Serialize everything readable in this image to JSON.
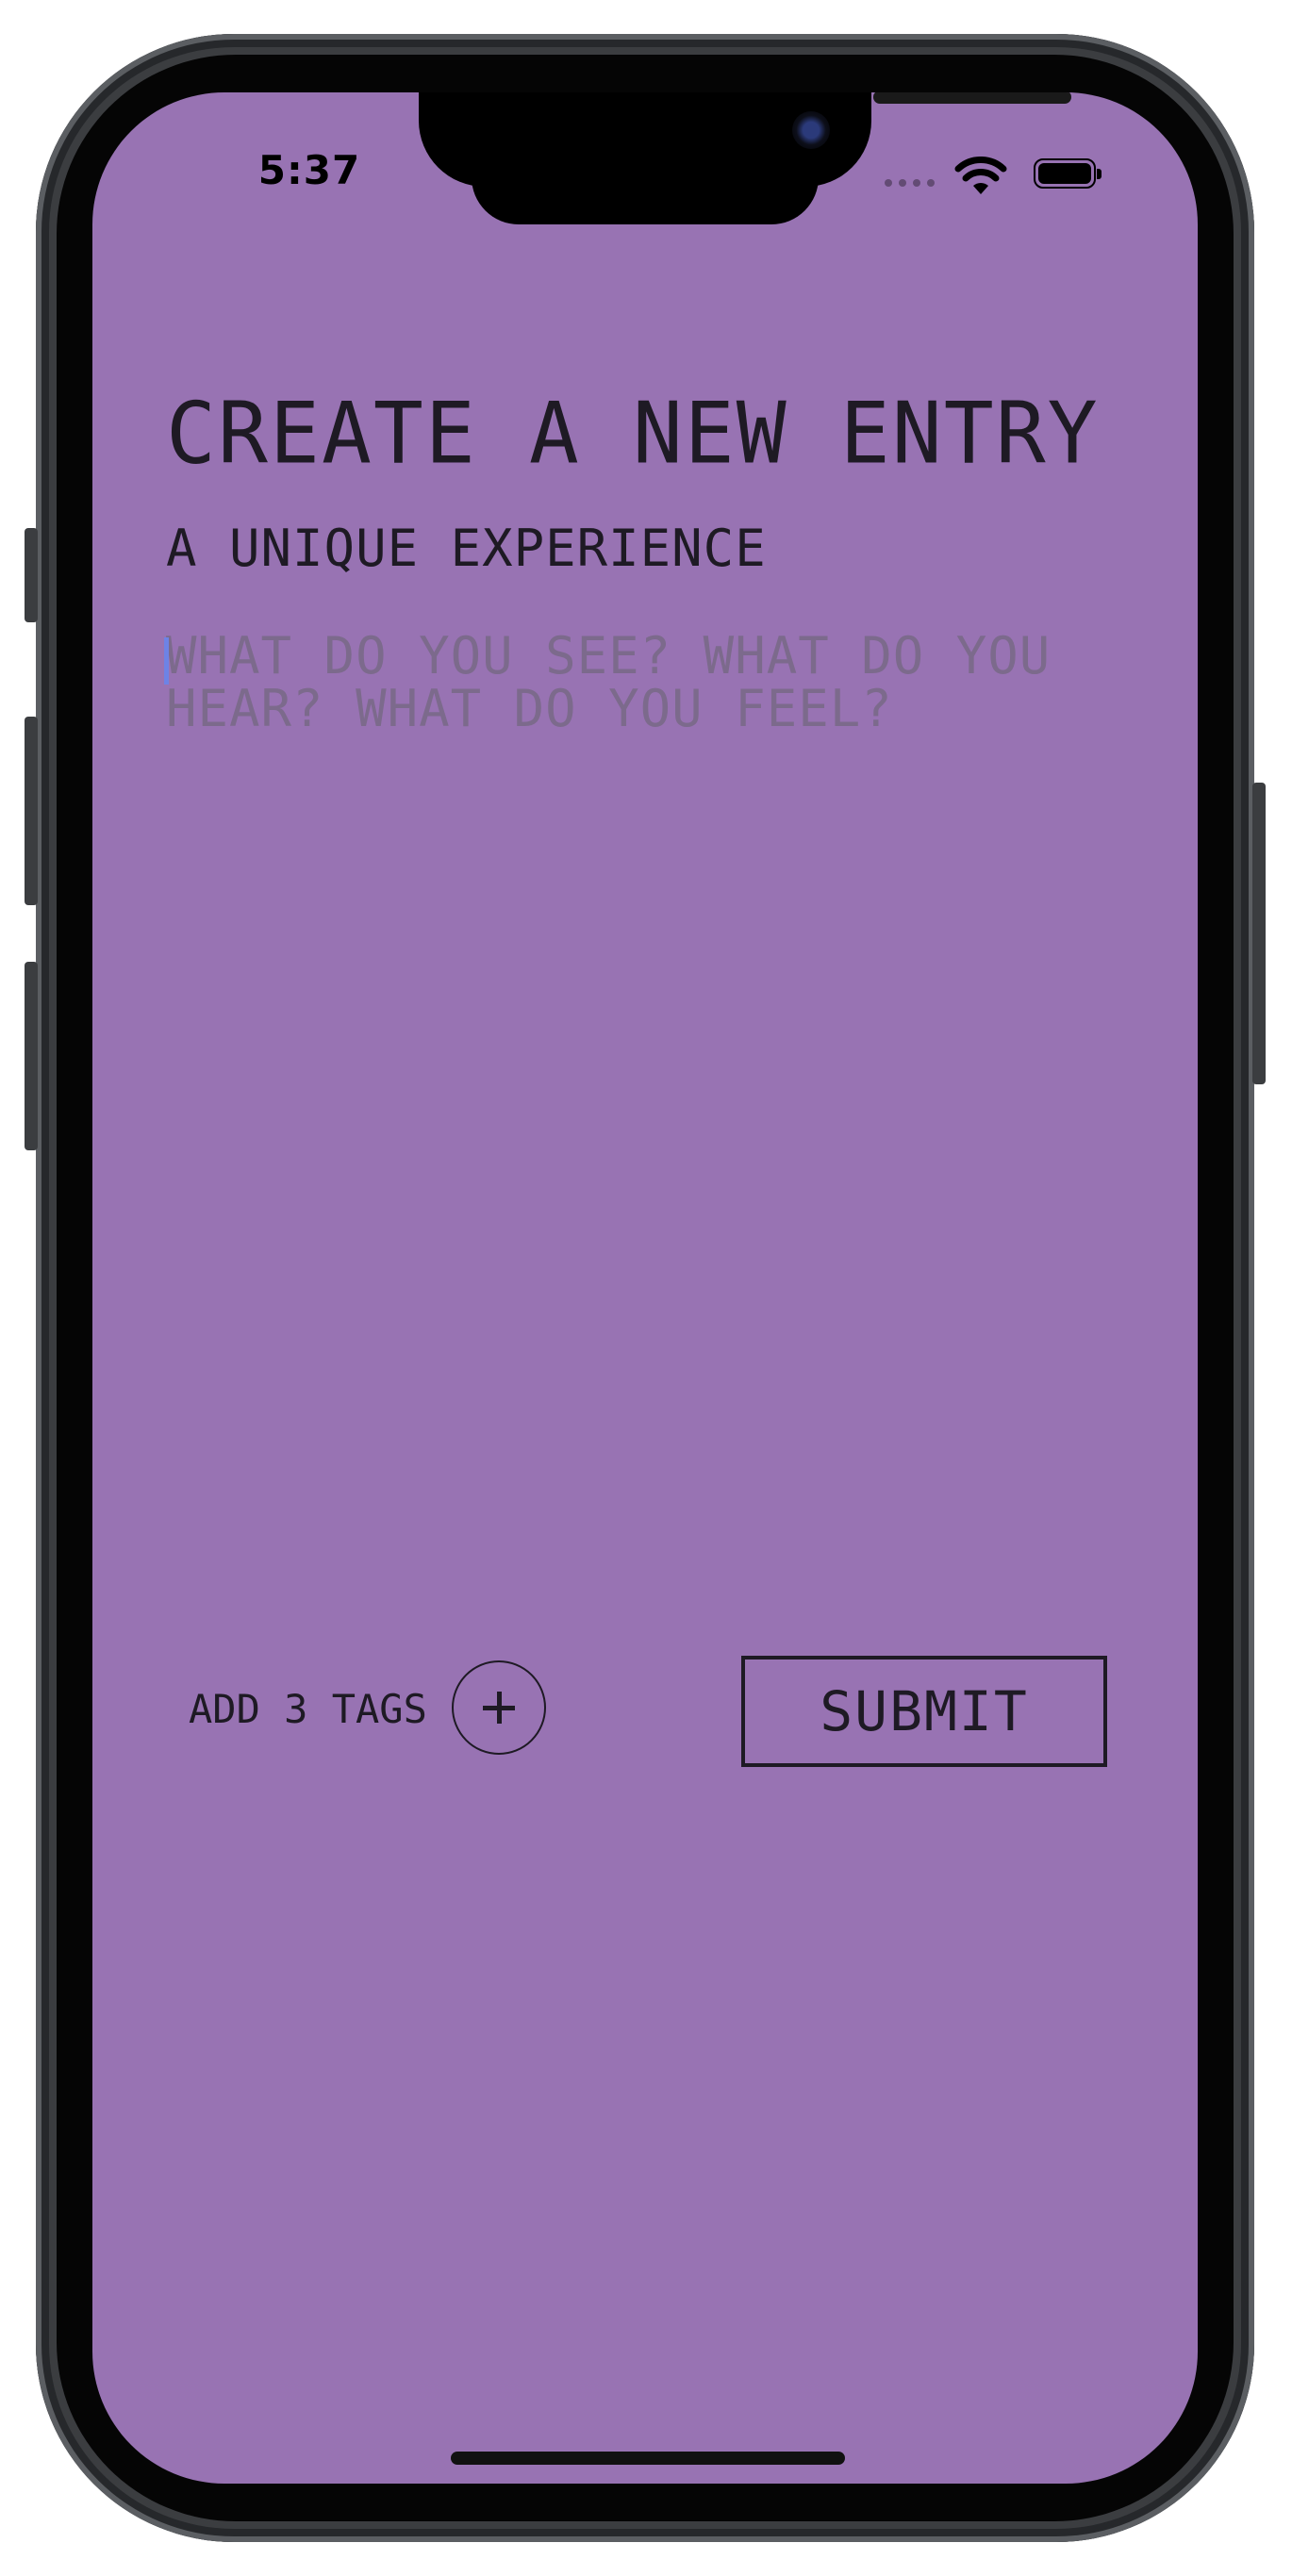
{
  "status_bar": {
    "time": "5:37"
  },
  "screen": {
    "title": "CREATE A NEW ENTRY",
    "subtitle": "A UNIQUE EXPERIENCE",
    "entry_placeholder": "WHAT DO YOU SEE? WHAT DO YOU HEAR? WHAT DO YOU FEEL?",
    "entry_value": "",
    "tags_label": "ADD 3 TAGS",
    "submit_label": "SUBMIT"
  },
  "icons": {
    "signal": "cellular-signal-icon",
    "wifi": "wifi-icon",
    "battery": "battery-icon",
    "add_tag": "plus-icon"
  },
  "colors": {
    "background": "#9873b3",
    "text": "#1e1a24",
    "placeholder": "#7c6a8c",
    "caret": "#6d83e6"
  }
}
